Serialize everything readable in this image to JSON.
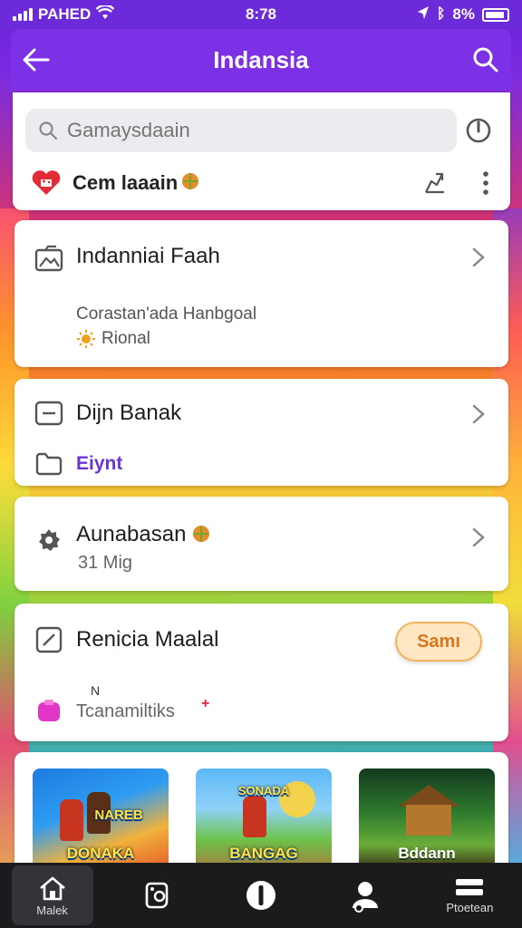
{
  "status_bar": {
    "carrier": "PAHED",
    "time": "8:78",
    "battery": "8%"
  },
  "header": {
    "title": "Indansia"
  },
  "search": {
    "placeholder": "Gamaysdaain"
  },
  "game": {
    "name": "Cem laaain"
  },
  "cards": [
    {
      "title": "Indanniai Faah",
      "subtitle": "Corastan'ada Hanbgoal",
      "detail": "Rional"
    },
    {
      "title": "Dijn Banak",
      "detail": "Eiynt"
    },
    {
      "title": "Aunabasan",
      "detail": "31 Mig"
    },
    {
      "title": "Renicia Maalal",
      "button": "Samı",
      "note": "N",
      "detail": "Tcanamiltiks"
    }
  ],
  "thumbnails": [
    {
      "caption": "DONAKA",
      "alt_top": "NAREB"
    },
    {
      "caption": "BANGAG",
      "alt_top": "SONADA"
    },
    {
      "caption": "Bddann"
    }
  ],
  "bottom_nav": [
    {
      "label": "Malek",
      "active": true
    },
    {
      "label": ""
    },
    {
      "label": ""
    },
    {
      "label": ""
    },
    {
      "label": "Ptoetean"
    }
  ],
  "colors": {
    "header_purple": "#7d31e6",
    "accent_purple": "#6a35d6",
    "pill_orange": "#d7761c",
    "nav_dark": "#1b1b1d"
  }
}
